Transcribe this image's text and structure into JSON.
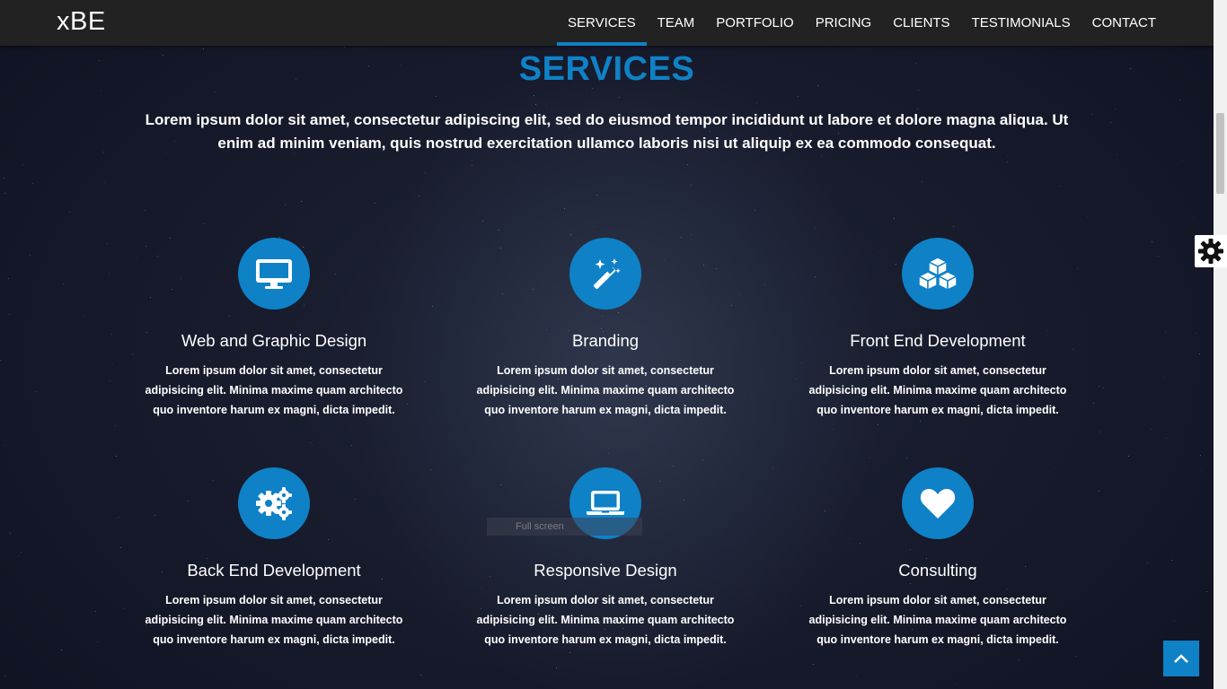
{
  "header": {
    "brand": "xBE",
    "nav": [
      {
        "label": "SERVICES",
        "active": true
      },
      {
        "label": "TEAM",
        "active": false
      },
      {
        "label": "PORTFOLIO",
        "active": false
      },
      {
        "label": "PRICING",
        "active": false
      },
      {
        "label": "CLIENTS",
        "active": false
      },
      {
        "label": "TESTIMONIALS",
        "active": false
      },
      {
        "label": "CONTACT",
        "active": false
      }
    ]
  },
  "section": {
    "title": "SERVICES",
    "lead": "Lorem ipsum dolor sit amet, consectetur adipiscing elit, sed do eiusmod tempor incididunt ut labore et dolore magna aliqua. Ut enim ad minim veniam, quis nostrud exercitation ullamco laboris nisi ut aliquip ex ea commodo consequat."
  },
  "services": [
    {
      "icon": "desktop-icon",
      "title": "Web and Graphic Design",
      "text": "Lorem ipsum dolor sit amet, consectetur adipisicing elit. Minima maxime quam architecto quo inventore harum ex magni, dicta impedit."
    },
    {
      "icon": "magic-wand-icon",
      "title": "Branding",
      "text": "Lorem ipsum dolor sit amet, consectetur adipisicing elit. Minima maxime quam architecto quo inventore harum ex magni, dicta impedit."
    },
    {
      "icon": "cubes-icon",
      "title": "Front End Development",
      "text": "Lorem ipsum dolor sit amet, consectetur adipisicing elit. Minima maxime quam architecto quo inventore harum ex magni, dicta impedit."
    },
    {
      "icon": "gears-icon",
      "title": "Back End Development",
      "text": "Lorem ipsum dolor sit amet, consectetur adipisicing elit. Minima maxime quam architecto quo inventore harum ex magni, dicta impedit."
    },
    {
      "icon": "laptop-icon",
      "title": "Responsive Design",
      "text": "Lorem ipsum dolor sit amet, consectetur adipisicing elit. Minima maxime quam architecto quo inventore harum ex magni, dicta impedit."
    },
    {
      "icon": "heart-icon",
      "title": "Consulting",
      "text": "Lorem ipsum dolor sit amet, consectetur adipisicing elit. Minima maxime quam architecto quo inventore harum ex magni, dicta impedit."
    }
  ],
  "overlay": {
    "fullscreen_label": "Full screen"
  },
  "colors": {
    "accent": "#0f81c7",
    "navbar": "#222222",
    "background": "#161a2b"
  }
}
